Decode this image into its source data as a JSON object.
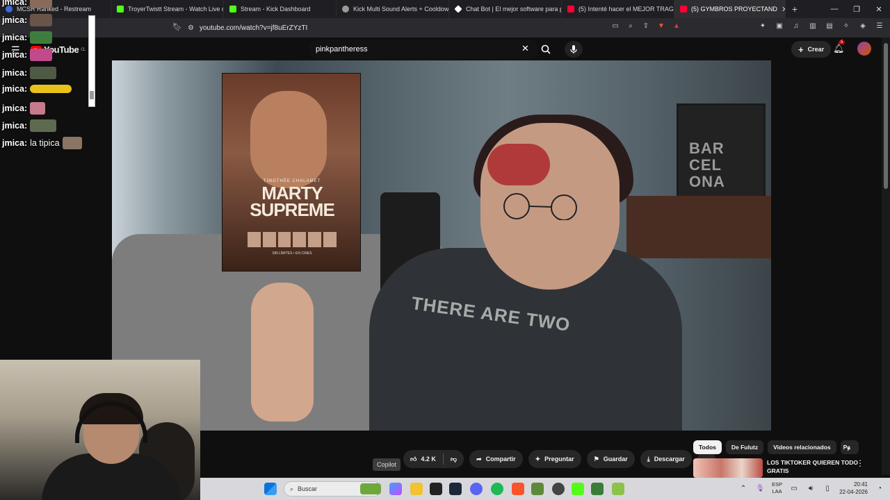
{
  "browser": {
    "tabs": [
      {
        "title": "MCSR Ranked - Restream",
        "color": "#3b6ad9"
      },
      {
        "title": "TroyerTwistt Stream - Watch Live on",
        "color": "#53fc18"
      },
      {
        "title": "Stream - Kick Dashboard",
        "color": "#53fc18"
      },
      {
        "title": "Kick Multi Sound Alerts + Cooldown",
        "color": "#9a9a9a"
      },
      {
        "title": "Chat Bot | El mejor software para po",
        "color": "#ffffff"
      },
      {
        "title": "(5) Intenté hacer el MEJOR TRAGO e",
        "color": "#ff0033"
      },
      {
        "title": "(5) GYMBROS PROYECTAND",
        "color": "#ff0033"
      }
    ],
    "url": "youtube.com/watch?v=jf8uErZYzTI"
  },
  "youtube": {
    "logo_text": "YouTube",
    "logo_region": "CL",
    "search_value": "pinkpantheress",
    "create_label": "Crear",
    "notification_count": "5"
  },
  "chat": {
    "messages": [
      {
        "user": "jmica:",
        "text": ""
      },
      {
        "user": "jmica:",
        "text": ""
      },
      {
        "user": "jmica:",
        "text": ""
      },
      {
        "user": "jmica:",
        "text": ""
      },
      {
        "user": "jmica:",
        "text": ""
      },
      {
        "user": "jmica:",
        "text": ""
      },
      {
        "user": "jmica:",
        "text": ""
      },
      {
        "user": "jmica:",
        "text": "la tipica"
      }
    ]
  },
  "video": {
    "poster_actor": "TIMOTHÉE CHALAMET",
    "poster_title_line1": "MARTY",
    "poster_title_line2": "SUPREME",
    "poster_footer": "SIN LÍMITES • EN CINES",
    "frame_text": "BAR CEL ONA",
    "shirt_text": "THERE ARE TWO"
  },
  "actions": {
    "tooltip": "Copilot",
    "like_count": "4.2 K",
    "share_label": "Compartir",
    "ask_label": "Preguntar",
    "save_label": "Guardar",
    "download_label": "Descargar"
  },
  "chips": [
    "Todos",
    "De Fulutz",
    "Videos relacionados",
    "Pa"
  ],
  "related": {
    "title": "LOS TIKTOKER QUIEREN TODO GRATIS"
  },
  "taskbar": {
    "search_label": "Buscar",
    "lang_line1": "ESP",
    "lang_line2": "LAA",
    "time": "20:41",
    "date": "22-04-2026"
  }
}
